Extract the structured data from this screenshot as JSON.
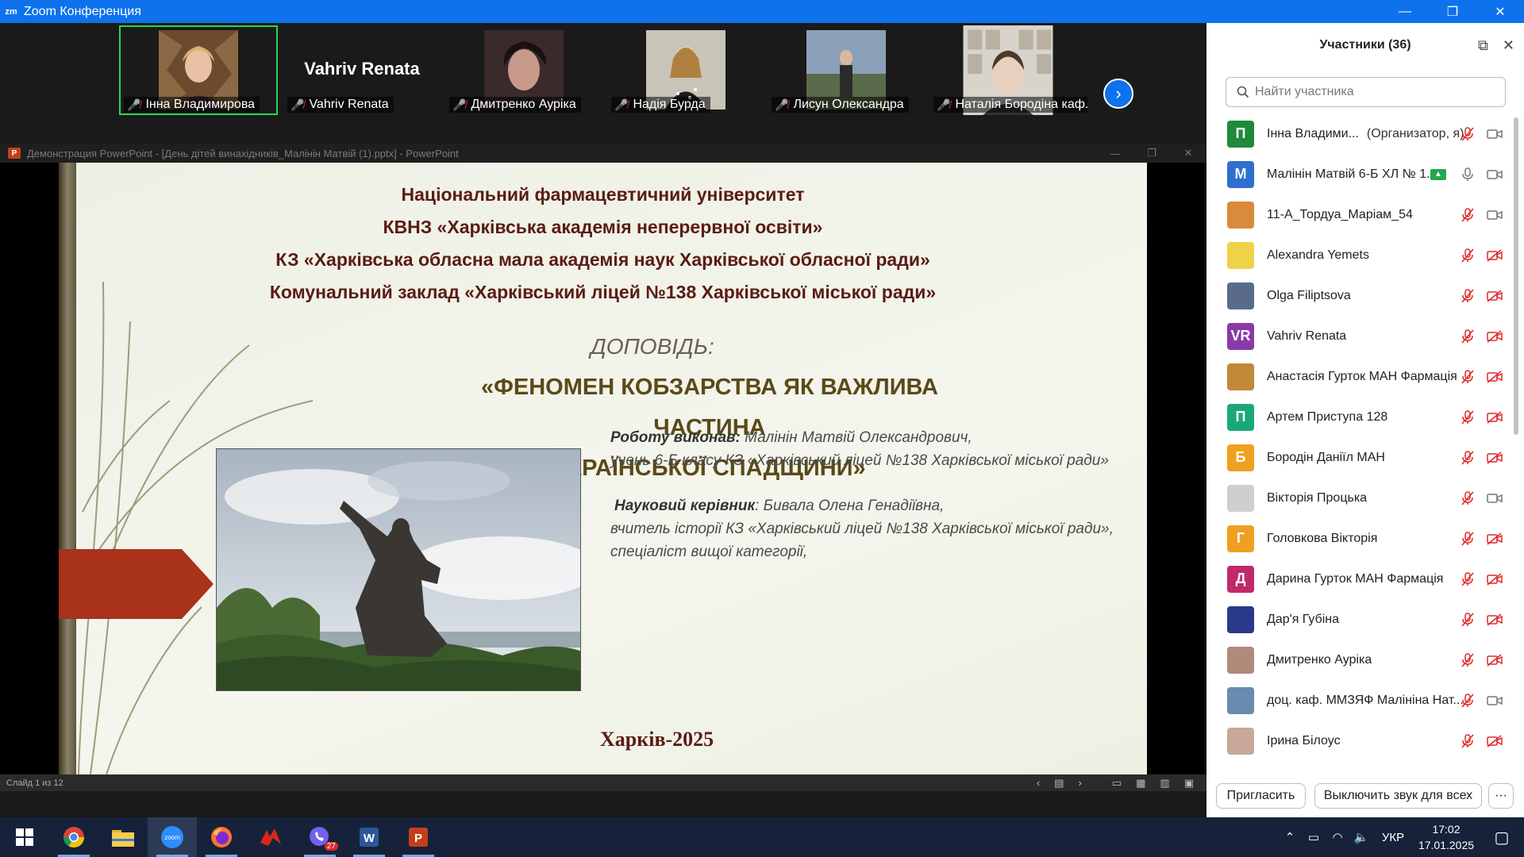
{
  "window": {
    "title": "Zoom Конференция",
    "logo_text": "zm",
    "minimize": "—",
    "restore": "❐",
    "close": "✕"
  },
  "gallery": {
    "tiles": [
      {
        "name": "Інна Владимирова",
        "active": true
      },
      {
        "name": "Vahriv Renata",
        "big_name": "Vahriv Renata"
      },
      {
        "name": "Дмитренко Аурiка"
      },
      {
        "name": "Надія Бурда"
      },
      {
        "name": "Лисун Олександра"
      },
      {
        "name": "Наталія Бородіна каф..."
      }
    ],
    "next_label": "›"
  },
  "powerpoint": {
    "title": "Демонстрация PowerPoint - [День дітей винахідників_Малінін Матвій (1).pptx] - PowerPoint",
    "icon_label": "P",
    "status_slide": "Слайд 1 из 12",
    "slide": {
      "header": [
        "Національний фармацевтичний університет",
        "КВНЗ «Харківська академія неперервної освіти»",
        "КЗ «Харківська обласна мала академія наук Харківської обласної ради»",
        "Комунальний заклад «Харківський ліцей №138 Харківської міської ради»"
      ],
      "report_label": "ДОПОВІДЬ:",
      "subject_line1": "«ФЕНОМЕН КОБЗАРСТВА ЯК ВАЖЛИВА ЧАСТИНА",
      "subject_line2": "УКРАЇНСЬКОЇ СПАДЩИНИ»",
      "author_label": "Роботу виконав:",
      "author_name": " Малінін Матвій Олександрович,",
      "author_class": "учень 6-Б класу  КЗ «Харківський ліцей №138 Харківської міської ради»",
      "advisor_label": "Науковий керівник",
      "advisor_name": ": Бивала Олена Генадіївна,",
      "advisor_position": "вчитель історії КЗ «Харківський ліцей №138 Харківської міської ради»,",
      "advisor_category": "спеціаліст вищої категорії,",
      "city_year": "Харків-2025"
    }
  },
  "participants": {
    "header": "Участники (36)",
    "search_placeholder": "Найти участника",
    "list": [
      {
        "name": "Інна Владими...",
        "role": "(Организатор, я)",
        "avatar_letter": "П",
        "avatar_color": "#1f8a3a",
        "mic": "muted",
        "cam": "on"
      },
      {
        "name": "Малінін Матвій 6-Б ХЛ № 1...",
        "avatar_letter": "М",
        "avatar_color": "#2f6fd0",
        "mic": "on",
        "cam": "on",
        "sharing": true
      },
      {
        "name": "11-А_Тордуа_Маріам_54",
        "avatar_letter": "",
        "avatar_color": "#d98a3a",
        "mic": "muted",
        "cam": "on"
      },
      {
        "name": "Alexandra Yemets",
        "avatar_letter": "",
        "avatar_color": "#f0d24a",
        "mic": "muted",
        "cam": "off"
      },
      {
        "name": "Olga Filiptsova",
        "avatar_letter": "",
        "avatar_color": "#5a6b8a",
        "mic": "muted",
        "cam": "off"
      },
      {
        "name": "Vahriv Renata",
        "avatar_letter": "VR",
        "avatar_color": "#8a3aa8",
        "mic": "muted",
        "cam": "off"
      },
      {
        "name": "Анастасія Гурток МАН Фармація",
        "avatar_letter": "",
        "avatar_color": "#c08a3a",
        "mic": "muted",
        "cam": "off"
      },
      {
        "name": "Артем Приступа 128",
        "avatar_letter": "П",
        "avatar_color": "#1aa87a",
        "mic": "muted",
        "cam": "off"
      },
      {
        "name": "Бородін Даніїл МАН",
        "avatar_letter": "Б",
        "avatar_color": "#f0a020",
        "mic": "muted",
        "cam": "off"
      },
      {
        "name": "Вікторія Процька",
        "avatar_letter": "",
        "avatar_color": "#cfcfcf",
        "mic": "muted",
        "cam": "on"
      },
      {
        "name": "Головкова Вікторія",
        "avatar_letter": "Г",
        "avatar_color": "#f0a020",
        "mic": "muted",
        "cam": "off"
      },
      {
        "name": "Дарина Гурток МАН Фармація",
        "avatar_letter": "Д",
        "avatar_color": "#c02a6a",
        "mic": "muted",
        "cam": "off"
      },
      {
        "name": "Дар'я Губіна",
        "avatar_letter": "",
        "avatar_color": "#2a3a8a",
        "mic": "muted",
        "cam": "off"
      },
      {
        "name": "Дмитренко Аурiка",
        "avatar_letter": "",
        "avatar_color": "#b08a7a",
        "mic": "muted",
        "cam": "off"
      },
      {
        "name": "доц. каф. ММЗЯФ Малініна Нат...",
        "avatar_letter": "",
        "avatar_color": "#6a8ab0",
        "mic": "muted",
        "cam": "on"
      },
      {
        "name": "Ірина Білоус",
        "avatar_letter": "",
        "avatar_color": "#c8a898",
        "mic": "muted",
        "cam": "off"
      }
    ],
    "invite_label": "Пригласить",
    "mute_all_label": "Выключить звук для всех",
    "more_label": "···"
  },
  "taskbar": {
    "apps": [
      "start",
      "chrome",
      "explorer",
      "zoom",
      "firefox",
      "app-red",
      "viber",
      "word",
      "powerpoint"
    ],
    "viber_badge": "27",
    "lang": "УКР",
    "time": "17:02",
    "date": "17.01.2025"
  },
  "colors": {
    "zoom_blue": "#0e72ed",
    "slide_title": "#5a1c14",
    "muted_red": "#e02828"
  }
}
